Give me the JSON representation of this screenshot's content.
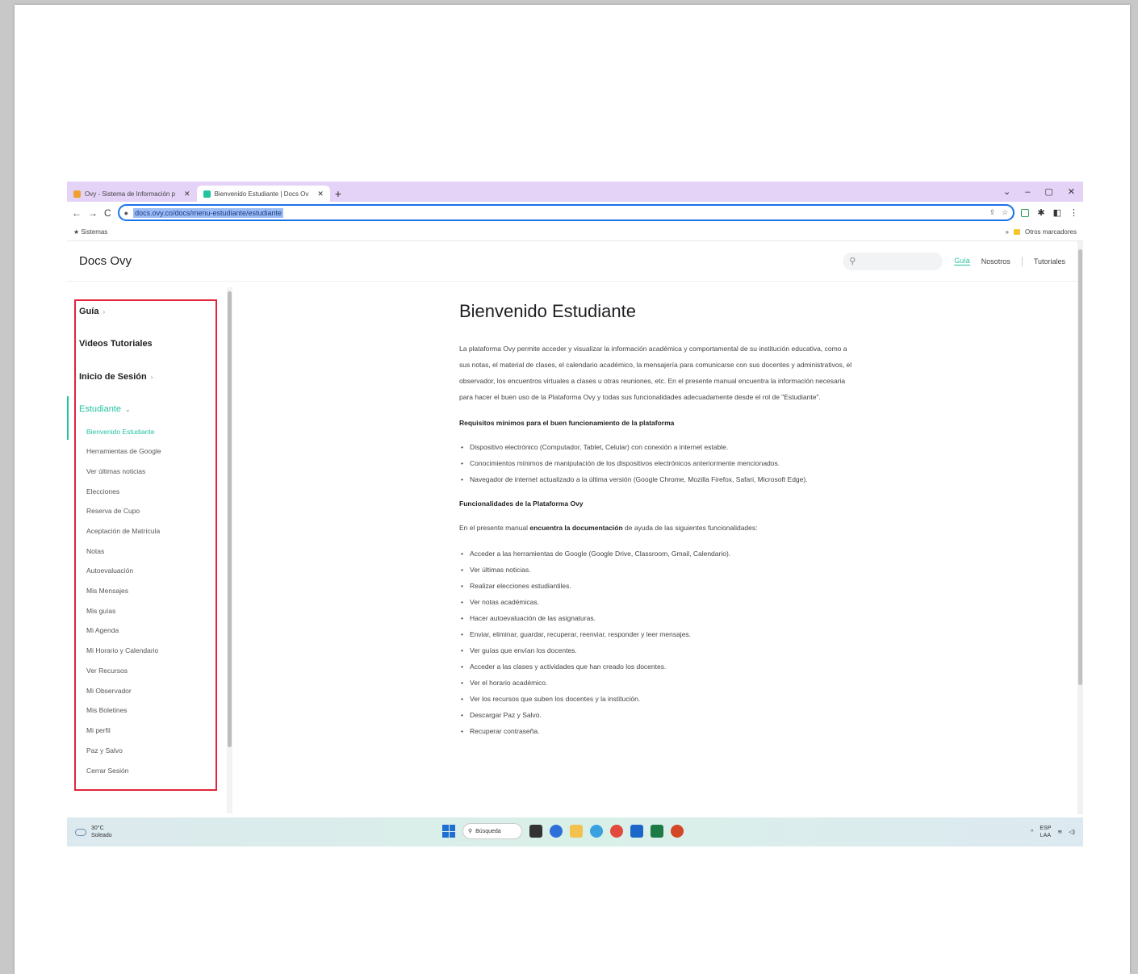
{
  "browser": {
    "tabs": [
      {
        "label": "Ovy - Sistema de Información p",
        "active": false
      },
      {
        "label": "Bienvenido Estudiante | Docs Ov",
        "active": true
      }
    ],
    "new_tab": "+",
    "window_controls": {
      "down": "⌄",
      "minimize": "–",
      "restore": "▢",
      "close": "✕"
    },
    "nav": {
      "back": "←",
      "forward": "→",
      "reload": "C"
    },
    "url": "docs.ovy.co/docs/menu-estudiante/estudiante",
    "bookmarks": {
      "left": "Sistemas",
      "right": "Otros marcadores"
    }
  },
  "site": {
    "logo": "Docs Ovy",
    "search_placeholder": "",
    "nav_links": [
      "Guía",
      "Nosotros",
      "Tutoriales"
    ]
  },
  "sidebar": {
    "categories": [
      {
        "label": "Guía",
        "has_chevron": true
      },
      {
        "label": "Videos Tutoriales",
        "has_chevron": false
      },
      {
        "label": "Inicio de Sesión",
        "has_chevron": true
      },
      {
        "label": "Estudiante",
        "has_chevron": true
      }
    ],
    "items": [
      "Bienvenido Estudiante",
      "Herramientas de Google",
      "Ver últimas noticias",
      "Elecciones",
      "Reserva de Cupo",
      "Aceptación de Matrícula",
      "Notas",
      "Autoevaluación",
      "Mis Mensajes",
      "Mis guías",
      "Mi Agenda",
      "Mi Horario y Calendario",
      "Ver Recursos",
      "Mi Observador",
      "Mis Boletines",
      "Mi perfil",
      "Paz y Salvo",
      "Cerrar Sesión"
    ]
  },
  "content": {
    "title": "Bienvenido Estudiante",
    "intro": "La plataforma Ovy permite acceder y visualizar la información académica y comportamental de su institución educativa, como a sus notas, el material de clases, el calendario académico, la mensajería para comunicarse con sus docentes y administrativos, el observador, los encuentros virtuales a clases u otras reuniones, etc. En el presente manual encuentra la información necesaria para hacer el buen uso de la Plataforma Ovy y todas sus funcionalidades adecuadamente desde el rol de \"Estudiante\".",
    "req_title": "Requisitos mínimos para el buen funcionamiento de la plataforma",
    "requirements": [
      "Dispositivo electrónico (Computador, Tablet, Celular) con conexión a internet estable.",
      "Conocimientos mínimos de manipulación de los dispositivos electrónicos anteriormente mencionados.",
      "Navegador de internet actualizado a la última versión (Google Chrome, Mozilla Firefox, Safari, Microsoft Edge)."
    ],
    "func_title": "Funcionalidades de la Plataforma Ovy",
    "func_intro_pre": "En el presente manual ",
    "func_intro_bold": "encuentra la documentación",
    "func_intro_post": " de ayuda de las siguientes funcionalidades:",
    "functions": [
      "Acceder a las herramientas de Google (Google Drive, Classroom, Gmail, Calendario).",
      "Ver últimas noticias.",
      "Realizar elecciones estudiantiles.",
      "Ver notas académicas.",
      "Hacer autoevaluación de las asignaturas.",
      "Enviar, eliminar, guardar, recuperar, reenviar, responder y leer mensajes.",
      "Ver guías que envían los docentes.",
      "Acceder a las clases y actividades que han creado los docentes.",
      "Ver el horario académico.",
      "Ver los recursos que suben los docentes y la institución.",
      "Descargar Paz y Salvo.",
      "Recuperar contraseña."
    ]
  },
  "taskbar": {
    "weather_temp": "30°C",
    "weather_desc": "Soleado",
    "search_label": "Búsqueda",
    "lang_top": "ESP",
    "lang_bottom": "LAA"
  },
  "colors": {
    "accent": "#25c2a0",
    "highlight_box": "#e0243a",
    "tab_bar": "#e5d3f7",
    "url_selection": "#9bbcf6"
  }
}
